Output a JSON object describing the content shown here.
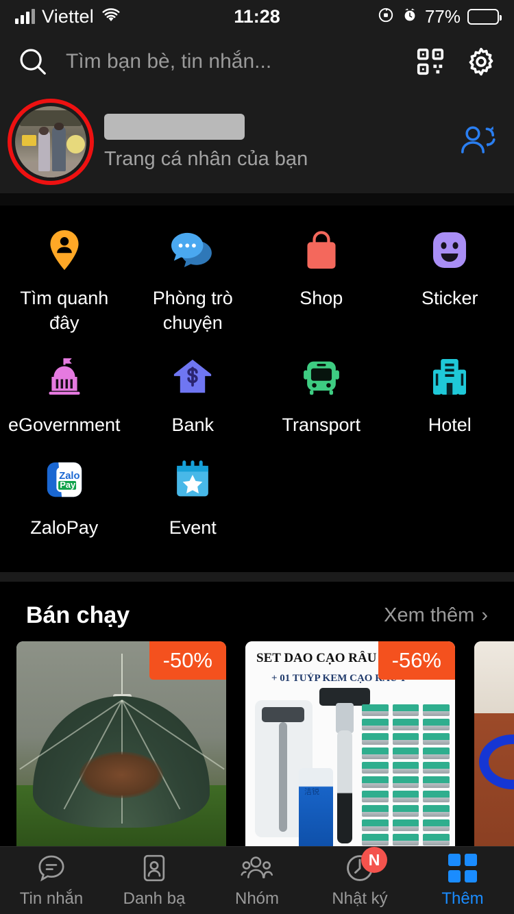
{
  "status_bar": {
    "carrier": "Viettel",
    "time": "11:28",
    "battery_percent": "77%",
    "battery_level": 77,
    "icons": [
      "signal-bars-icon",
      "wifi-icon",
      "rotation-lock-icon",
      "alarm-clock-icon",
      "battery-icon"
    ]
  },
  "search": {
    "placeholder": "Tìm bạn bè, tin nhắn...",
    "search_icon": "search-icon",
    "qr_icon": "qr-code-icon",
    "settings_icon": "gear-icon"
  },
  "profile": {
    "name_redacted": "",
    "subtitle": "Trang cá nhân của bạn",
    "avatar_icon": "avatar",
    "sync_icon": "add-friend-sync-icon",
    "annotation_color": "#ee1111"
  },
  "shortcuts": [
    {
      "label": "Tìm quanh đây",
      "icon": "location-pin-person-icon",
      "color": "#ffa826"
    },
    {
      "label": "Phòng trò chuyện",
      "icon": "chat-bubbles-icon",
      "color": "#4aa8f0"
    },
    {
      "label": "Shop",
      "icon": "shopping-bag-icon",
      "color": "#f4685c"
    },
    {
      "label": "Sticker",
      "icon": "smiley-sticker-icon",
      "color": "#a98ef5"
    },
    {
      "label": "eGovernment",
      "icon": "capitol-building-icon",
      "color": "#e57ae0"
    },
    {
      "label": "Bank",
      "icon": "bank-dollar-house-icon",
      "color": "#6f76f2"
    },
    {
      "label": "Transport",
      "icon": "bus-icon",
      "color": "#3ecc82"
    },
    {
      "label": "Hotel",
      "icon": "hotel-building-icon",
      "color": "#1fc8d8"
    },
    {
      "label": "ZaloPay",
      "icon": "zalopay-logo-icon",
      "color": "#1a67d2"
    },
    {
      "label": "Event",
      "icon": "calendar-star-icon",
      "color": "#48b8e8"
    }
  ],
  "zalopay_logo": {
    "top": "Zalo",
    "bottom": "Pay"
  },
  "best_selling": {
    "title": "Bán chạy",
    "more_label": "Xem thêm",
    "more_chevron": "›",
    "products": [
      {
        "discount": "-50%",
        "alt": "fishing-net-trap",
        "title": "",
        "subtitle": ""
      },
      {
        "discount": "-56%",
        "alt": "razor-set",
        "title": "SET DAO CẠO RÂU KÈM 36 LƯỠI",
        "subtitle": "+ 01 TUÝP KEM CẠO RÂU T"
      },
      {
        "discount": "",
        "alt": "blue-hose",
        "title": "",
        "subtitle": ""
      }
    ],
    "badge_color": "#f4511e"
  },
  "bottom_nav": {
    "active_color": "#1a8cff",
    "items": [
      {
        "label": "Tin nhắn",
        "icon": "chat-bubble-icon",
        "badge": "",
        "active": false
      },
      {
        "label": "Danh bạ",
        "icon": "contact-card-icon",
        "badge": "",
        "active": false
      },
      {
        "label": "Nhóm",
        "icon": "people-group-icon",
        "badge": "",
        "active": false
      },
      {
        "label": "Nhật ký",
        "icon": "clock-icon",
        "badge": "N",
        "active": false
      },
      {
        "label": "Thêm",
        "icon": "grid-squares-icon",
        "badge": "",
        "active": true
      }
    ]
  }
}
